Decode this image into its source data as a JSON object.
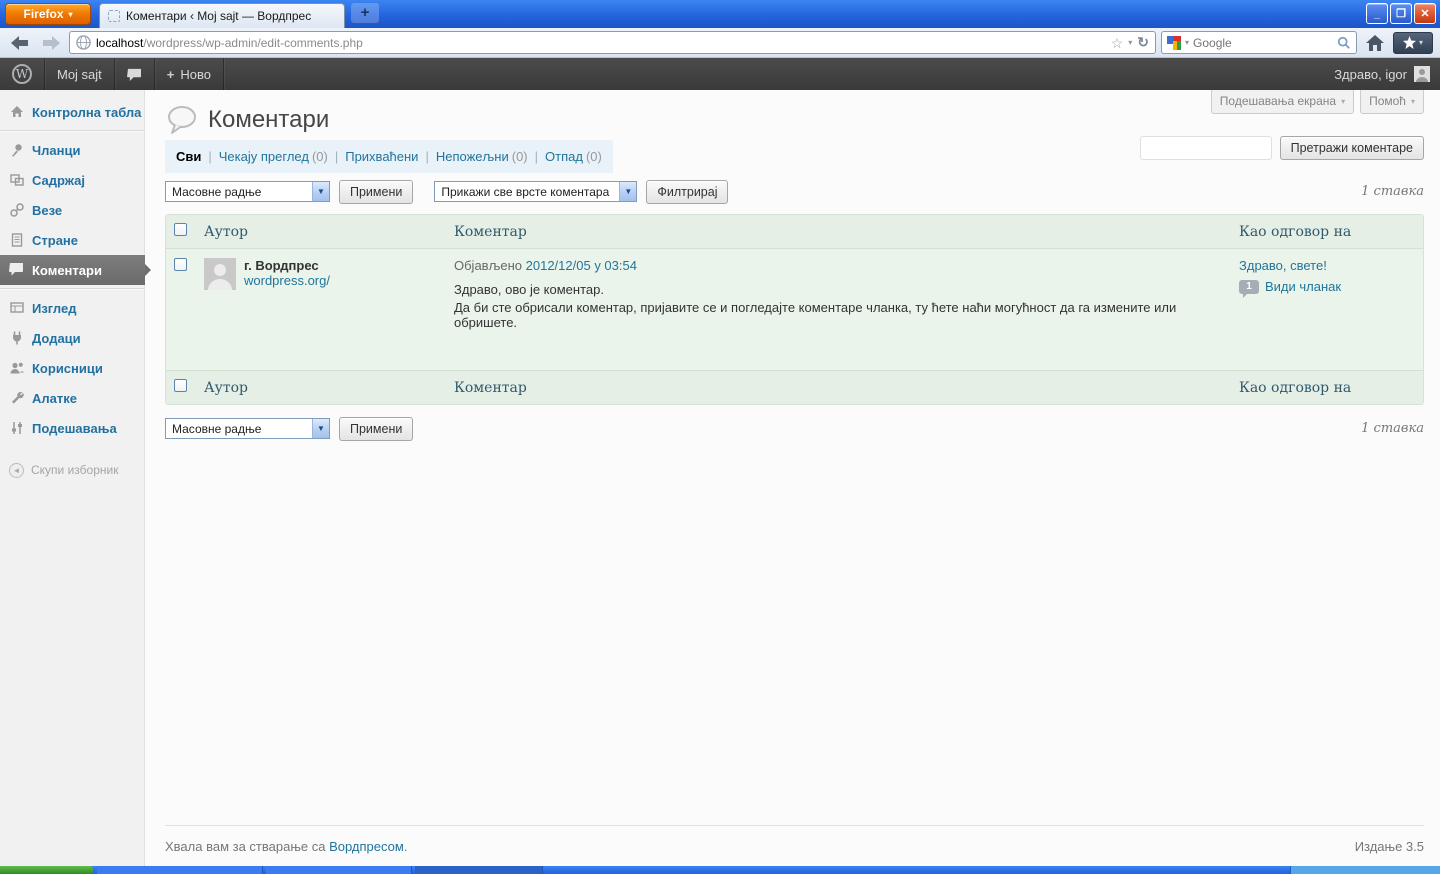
{
  "colors": {
    "link": "#21759b",
    "adminbar_bg": "#3c3c3c",
    "titlebar_blue": "#2464de",
    "sidebar_active_bg": "#6e6e6e",
    "table_tint": "#ebf4eb",
    "taskbar_green": "#3f9c34",
    "taskbar_blue": "#2f71e0"
  },
  "icons": {
    "caret_down": "▾",
    "dropdown_arrow": "▼",
    "plus": "+",
    "star_outline": "☆",
    "reload": "↻",
    "pipe": "|",
    "collapse_arrow": "◄"
  },
  "browser": {
    "menu_button": "Firefox",
    "tab_title": "Коментари ‹ Moj sajt — Вордпрес",
    "url_host": "localhost",
    "url_path": "/wordpress/wp-admin/edit-comments.php",
    "search_placeholder": "Google"
  },
  "window": {
    "minimize": "_",
    "restore": "❐",
    "close": "✕"
  },
  "adminbar": {
    "wp_logo": "W",
    "site_name": "Moj sajt",
    "new_label": "Ново",
    "greeting": "Здраво, igor"
  },
  "sidebar": {
    "items": [
      {
        "label": "Контролна табла"
      },
      {
        "label": "Чланци"
      },
      {
        "label": "Садржај"
      },
      {
        "label": "Везе"
      },
      {
        "label": "Стране"
      },
      {
        "label": "Коментари"
      },
      {
        "label": "Изглед"
      },
      {
        "label": "Додаци"
      },
      {
        "label": "Корисници"
      },
      {
        "label": "Алатке"
      },
      {
        "label": "Подешавања"
      }
    ],
    "collapse_label": "Скупи изборник"
  },
  "page": {
    "title": "Коментари",
    "screen_options_label": "Подешавања екрана",
    "help_label": "Помоћ",
    "search_button": "Претражи коментаре",
    "items_count": "1 ставка"
  },
  "filters": [
    {
      "label": "Сви"
    },
    {
      "label": "Чекају преглед",
      "count": "(0)"
    },
    {
      "label": "Прихваћени"
    },
    {
      "label": "Непожељни",
      "count": "(0)"
    },
    {
      "label": "Отпад",
      "count": "(0)"
    }
  ],
  "bulk": {
    "action_select": "Масовне радње",
    "apply_button": "Примени",
    "type_select": "Прикажи све врсте коментара",
    "filter_button": "Филтрирај"
  },
  "table": {
    "headers": [
      "Аутор",
      "Коментар",
      "Као одговор на"
    ],
    "comment": {
      "author": "г. Вордпрес",
      "author_url": "wordpress.org/",
      "submitted_label": "Објављено",
      "submitted_date": "2012/12/05 у 03:54",
      "line1": "Здраво, ово је коментар.",
      "line2": "Да би сте обрисали коментар, пријавите се и погледајте коментаре чланка, ту ћете наћи могућност да га измените или обришете.",
      "in_reply_to": "Здраво, свете!",
      "reply_count": "1",
      "view_post": "Види чланак"
    }
  },
  "footer": {
    "thanks_text": "Хвала вам за стварање са",
    "thanks_link": "Вордпресом",
    "thanks_suffix": ".",
    "version": "Издање 3.5"
  }
}
